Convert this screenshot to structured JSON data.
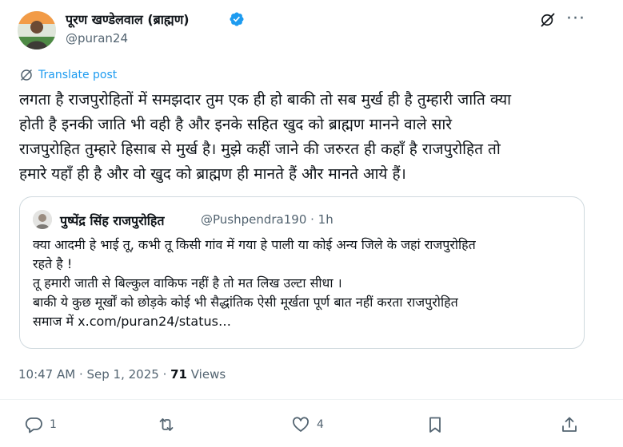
{
  "author": {
    "display_name": "पूरण खण्डेलवाल (ब्राह्मण)",
    "handle": "@puran24"
  },
  "translate_label": "Translate post",
  "post_lines": [
    "लगता है राजपुरोहितों में समझदार तुम एक ही हो बाकी तो सब मुर्ख ही है तुम्हारी जाति क्या",
    "होती है इनकी जाति भी वही है और इनके सहित खुद को ब्राह्मण मानने वाले सारे",
    "राजपुरोहित तुम्हारे हिसाब से मुर्ख है। मुझे कहीं जाने की जरुरत ही कहाँ है राजपुरोहित तो",
    "हमारे यहाँ ही है और वो खुद को ब्राह्मण ही मानते हैं और मानते आये हैं।"
  ],
  "quote": {
    "display_name": "पुष्पेंद्र सिंह राजपुरोहित",
    "handle_time": "@Pushpendra190 · 1h",
    "lines": [
      "क्या आदमी हे भाई तू, कभी तू किसी गांव में गया हे पाली या कोई अन्य जिले के जहां राजपुरोहित",
      "रहते है !",
      "तू हमारी जाती से बिल्कुल वाकिफ नहीं है तो मत लिख उल्टा सीधा ।",
      "बाकी ये कुछ मूर्खों को छोड़के कोई भी सैद्धांतिक ऐसी मूर्खता पूर्ण बात नहीं करता राजपुरोहित",
      "समाज में x.com/puran24/status…"
    ]
  },
  "meta": {
    "time_date": "10:47 AM · Sep 1, 2025 · ",
    "views_count": "71",
    "views_label": " Views"
  },
  "actions": {
    "replies": "1",
    "likes": "4"
  },
  "icons": [
    "verified-badge-icon",
    "grok-icon",
    "more-icon",
    "translate-icon",
    "reply-icon",
    "repost-icon",
    "like-icon",
    "bookmark-icon",
    "share-icon"
  ],
  "colors": {
    "accent": "#1d9bf0",
    "text": "#0f1419",
    "secondary": "#536471",
    "border": "#cfd9de"
  }
}
